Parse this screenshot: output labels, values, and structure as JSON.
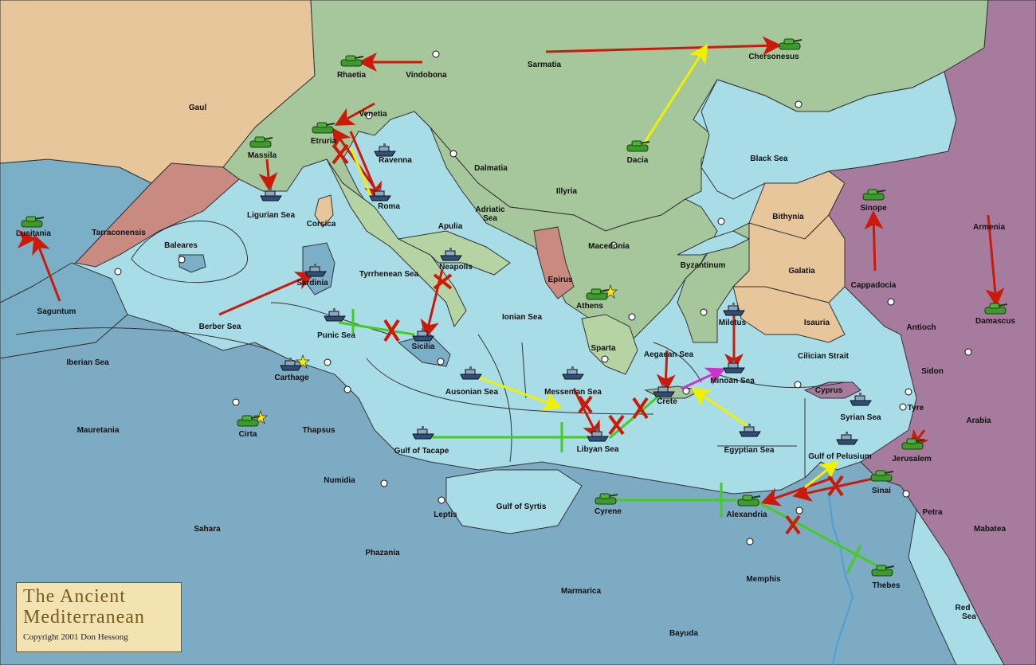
{
  "title": {
    "line1": "The Ancient",
    "line2": "Mediterranean",
    "copyright": "Copyright  2001  Don Hessong"
  },
  "colors": {
    "sea": "#a8dde8",
    "deep_sea": "#7bafc7",
    "land_green": "#a6c79c",
    "land_tan": "#e6c69a",
    "land_rose": "#c98a82",
    "land_purple": "#a77b9d",
    "land_olive": "#b6d3a3",
    "africa": "#7dabc4",
    "army": "#3d9a2c",
    "fleet": "#4a6a8a",
    "move_red": "#cc1a0a",
    "support_yellow": "#f0f000",
    "convoy_green": "#44cc22",
    "retreat_magenta": "#cc33cc",
    "supply_star": "#ffee00"
  },
  "labels": [
    {
      "id": "gaul",
      "text": "Gaul"
    },
    {
      "id": "rhaetia",
      "text": "Rhaetia"
    },
    {
      "id": "vindobona",
      "text": "Vindobona"
    },
    {
      "id": "sarmatia",
      "text": "Sarmatia"
    },
    {
      "id": "chersonesus",
      "text": "Chersonesus"
    },
    {
      "id": "massila",
      "text": "Massila"
    },
    {
      "id": "etruria",
      "text": "Etruria"
    },
    {
      "id": "venetia",
      "text": "Venetia"
    },
    {
      "id": "ravenna",
      "text": "Ravenna"
    },
    {
      "id": "dalmatia",
      "text": "Dalmatia"
    },
    {
      "id": "dacia",
      "text": "Dacia"
    },
    {
      "id": "black_sea",
      "text": "Black Sea"
    },
    {
      "id": "illyria",
      "text": "Illyria"
    },
    {
      "id": "ligurian_sea",
      "text": "Ligurian Sea"
    },
    {
      "id": "roma",
      "text": "Roma"
    },
    {
      "id": "adriatic",
      "text": "Adriatic"
    },
    {
      "id": "adriatic_sea",
      "text": "Sea"
    },
    {
      "id": "bithynia",
      "text": "Bithynia"
    },
    {
      "id": "sinope",
      "text": "Sinope"
    },
    {
      "id": "armenia",
      "text": "Armenia"
    },
    {
      "id": "lusitania",
      "text": "Lusitania"
    },
    {
      "id": "tarraconensis",
      "text": "Tarraconensis"
    },
    {
      "id": "corsica",
      "text": "Corsica"
    },
    {
      "id": "apulia",
      "text": "Apulia"
    },
    {
      "id": "baleares",
      "text": "Baleares"
    },
    {
      "id": "macedonia",
      "text": "Macedonia"
    },
    {
      "id": "byzantinum",
      "text": "Byzantinum"
    },
    {
      "id": "galatia",
      "text": "Galatia"
    },
    {
      "id": "neapolis",
      "text": "Neapolis"
    },
    {
      "id": "sardinia",
      "text": "Sardinia"
    },
    {
      "id": "tyrrhenean_sea",
      "text": "Tyrrhenean Sea"
    },
    {
      "id": "epirus",
      "text": "Epirus"
    },
    {
      "id": "cappadocia",
      "text": "Cappadocia"
    },
    {
      "id": "athens",
      "text": "Athens"
    },
    {
      "id": "saguntum",
      "text": "Saguntum"
    },
    {
      "id": "ionian_sea",
      "text": "Ionian Sea"
    },
    {
      "id": "damascus",
      "text": "Damascus"
    },
    {
      "id": "berber_sea",
      "text": "Berber Sea"
    },
    {
      "id": "miletus",
      "text": "Miletus"
    },
    {
      "id": "isauria",
      "text": "Isauria"
    },
    {
      "id": "antioch",
      "text": "Antioch"
    },
    {
      "id": "punic_sea",
      "text": "Punic Sea"
    },
    {
      "id": "sicilia",
      "text": "Sicilia"
    },
    {
      "id": "sparta",
      "text": "Sparta"
    },
    {
      "id": "aegaean_sea",
      "text": "Aegaean Sea"
    },
    {
      "id": "cilician_strait",
      "text": "Cilician Strait"
    },
    {
      "id": "iberian_sea",
      "text": "Iberian Sea"
    },
    {
      "id": "sidon",
      "text": "Sidon"
    },
    {
      "id": "carthage",
      "text": "Carthage"
    },
    {
      "id": "minoan_sea",
      "text": "Minoan Sea"
    },
    {
      "id": "ausonian_sea",
      "text": "Ausonian Sea"
    },
    {
      "id": "messenian_sea",
      "text": "Messenian Sea"
    },
    {
      "id": "cyprus",
      "text": "Cyprus"
    },
    {
      "id": "crete",
      "text": "Crete"
    },
    {
      "id": "tyre",
      "text": "Tyre"
    },
    {
      "id": "syrian_sea",
      "text": "Syrian Sea"
    },
    {
      "id": "arabia",
      "text": "Arabia"
    },
    {
      "id": "mauretania",
      "text": "Mauretania"
    },
    {
      "id": "cirta",
      "text": "Cirta"
    },
    {
      "id": "thapsus",
      "text": "Thapsus"
    },
    {
      "id": "gulf_of_tacape",
      "text": "Gulf of Tacape"
    },
    {
      "id": "libyan_sea",
      "text": "Libyan Sea"
    },
    {
      "id": "egyptian_sea",
      "text": "Egyptian Sea"
    },
    {
      "id": "jerusalem",
      "text": "Jerusalem"
    },
    {
      "id": "gulf_of_pelusium",
      "text": "Gulf of Pelusium"
    },
    {
      "id": "numidia",
      "text": "Numidia"
    },
    {
      "id": "sinai",
      "text": "Sinai"
    },
    {
      "id": "gulf_of_syrtis",
      "text": "Gulf of Syrtis"
    },
    {
      "id": "cyrene",
      "text": "Cyrene"
    },
    {
      "id": "alexandria",
      "text": "Alexandria"
    },
    {
      "id": "leptis",
      "text": "Leptis"
    },
    {
      "id": "petra",
      "text": "Petra"
    },
    {
      "id": "sahara",
      "text": "Sahara"
    },
    {
      "id": "mabatea",
      "text": "Mabatea"
    },
    {
      "id": "phazania",
      "text": "Phazania"
    },
    {
      "id": "memphis",
      "text": "Memphis"
    },
    {
      "id": "marmarica",
      "text": "Marmarica"
    },
    {
      "id": "thebes",
      "text": "Thebes"
    },
    {
      "id": "red",
      "text": "Red"
    },
    {
      "id": "red_sea",
      "text": "Sea"
    },
    {
      "id": "bayuda",
      "text": "Bayuda"
    }
  ],
  "units": [
    {
      "type": "army",
      "at": "Rhaetia"
    },
    {
      "type": "army",
      "at": "Chersonesus"
    },
    {
      "type": "army",
      "at": "Massila"
    },
    {
      "type": "army",
      "at": "Etruria"
    },
    {
      "type": "army",
      "at": "Dacia"
    },
    {
      "type": "army",
      "at": "Lusitania"
    },
    {
      "type": "army",
      "at": "Sinope"
    },
    {
      "type": "army",
      "at": "Athens"
    },
    {
      "type": "army",
      "at": "Damascus"
    },
    {
      "type": "army",
      "at": "Cirta"
    },
    {
      "type": "army",
      "at": "Jerusalem"
    },
    {
      "type": "army",
      "at": "Sinai"
    },
    {
      "type": "army",
      "at": "Cyrene"
    },
    {
      "type": "army",
      "at": "Alexandria"
    },
    {
      "type": "army",
      "at": "Thebes"
    },
    {
      "type": "fleet",
      "at": "Ravenna"
    },
    {
      "type": "fleet",
      "at": "Ligurian Sea"
    },
    {
      "type": "fleet",
      "at": "Roma"
    },
    {
      "type": "fleet",
      "at": "Neapolis"
    },
    {
      "type": "fleet",
      "at": "Sardinia"
    },
    {
      "type": "fleet",
      "at": "Punic Sea"
    },
    {
      "type": "fleet",
      "at": "Sicilia"
    },
    {
      "type": "fleet",
      "at": "Carthage"
    },
    {
      "type": "fleet",
      "at": "Miletus"
    },
    {
      "type": "fleet",
      "at": "Minoan Sea"
    },
    {
      "type": "fleet",
      "at": "Ausonian Sea"
    },
    {
      "type": "fleet",
      "at": "Messenian Sea"
    },
    {
      "type": "fleet",
      "at": "Crete"
    },
    {
      "type": "fleet",
      "at": "Syrian Sea"
    },
    {
      "type": "fleet",
      "at": "Gulf of Tacape"
    },
    {
      "type": "fleet",
      "at": "Libyan Sea"
    },
    {
      "type": "fleet",
      "at": "Egyptian Sea"
    },
    {
      "type": "fleet",
      "at": "Gulf of Pelusium"
    }
  ]
}
